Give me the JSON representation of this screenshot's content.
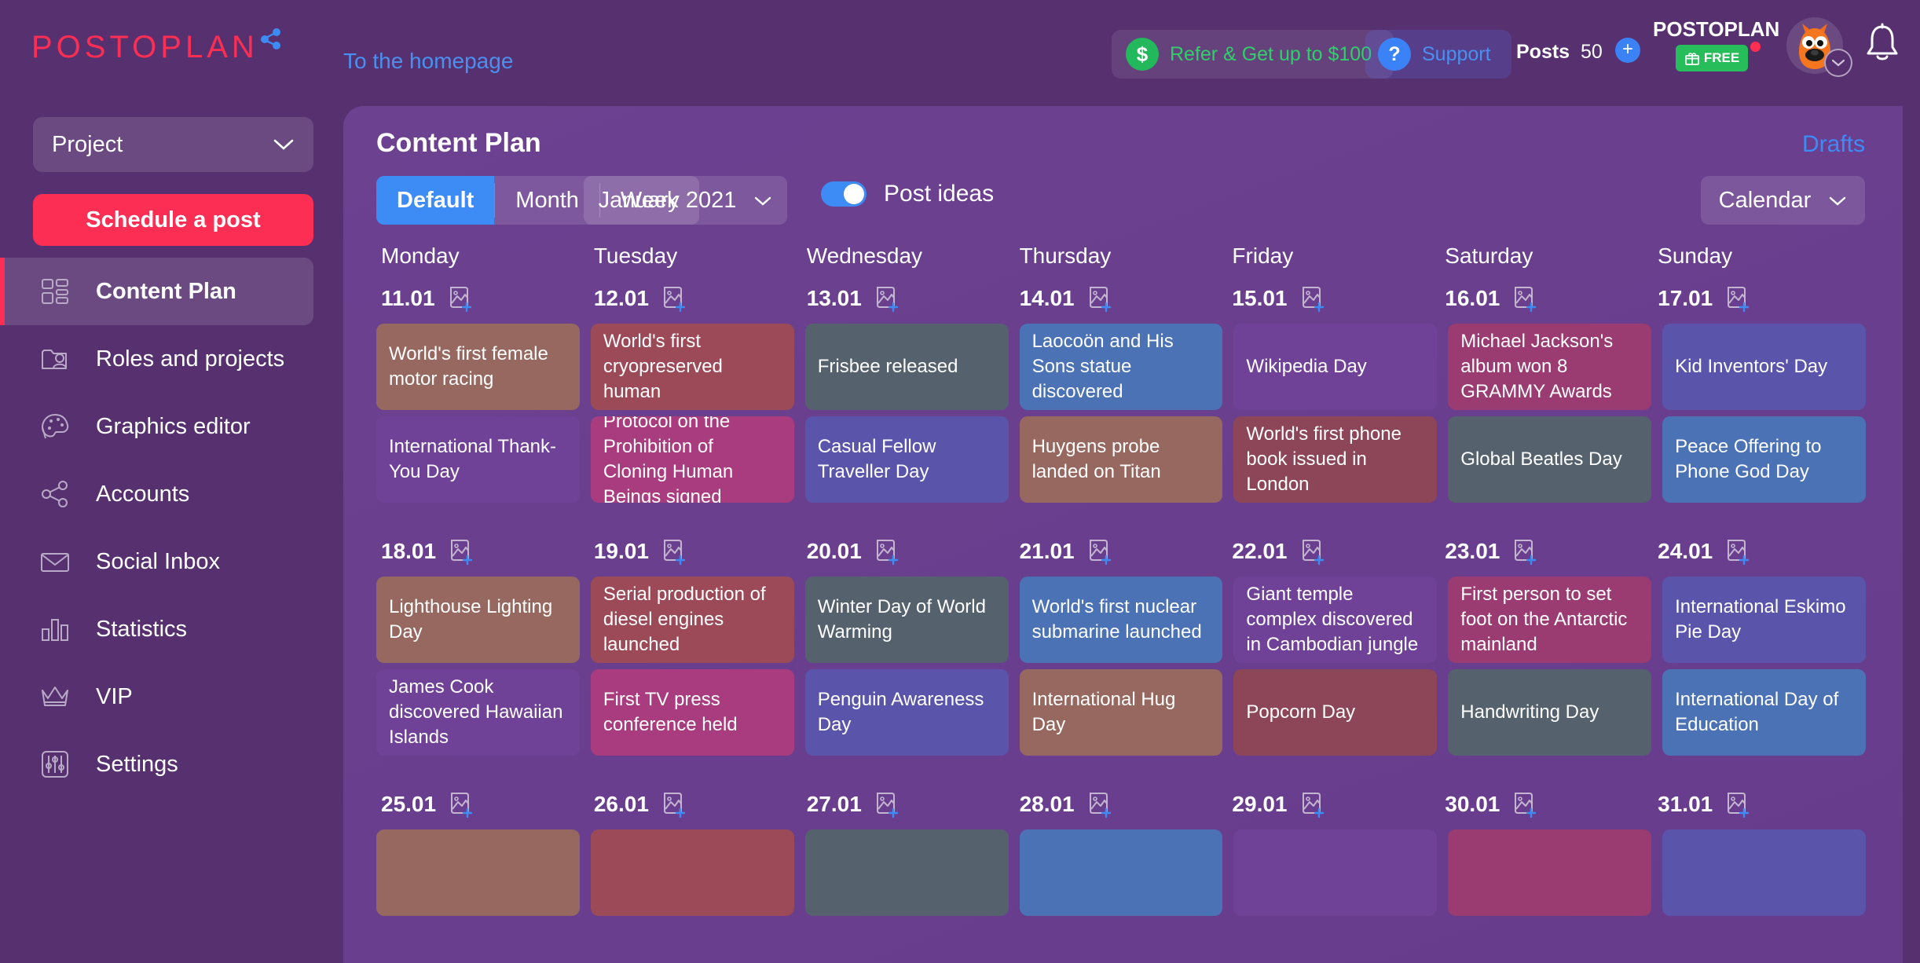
{
  "brand": {
    "logo_text": "POSTOPLAN",
    "logo_color": "#fd2e54",
    "share_icon": "share-icon"
  },
  "header": {
    "home_link": "To the homepage",
    "refer": {
      "label": "Refer & Get up to $100",
      "icon": "dollar-icon",
      "color": "#2fd06a"
    },
    "support": {
      "label": "Support",
      "icon": "question-icon",
      "color": "#4a90ef"
    },
    "posts": {
      "label": "Posts",
      "count": "50",
      "add_icon": "plus-icon"
    },
    "plan": {
      "name": "POSTOPLAN",
      "badge": "FREE",
      "badge_icon": "gift-icon",
      "badge_color": "#27bd5a"
    },
    "avatar": {
      "name": "avatar",
      "chevron": "chevron-down-icon"
    },
    "bell": "bell-icon"
  },
  "sidebar": {
    "project_select": {
      "label": "Project",
      "chevron": "chevron-down-icon"
    },
    "schedule_button": "Schedule a post",
    "items": [
      {
        "label": "Content Plan",
        "icon": "grid-icon",
        "active": true
      },
      {
        "label": "Roles and projects",
        "icon": "folder-user-icon",
        "active": false
      },
      {
        "label": "Graphics editor",
        "icon": "palette-icon",
        "active": false
      },
      {
        "label": "Accounts",
        "icon": "share-nodes-icon",
        "active": false
      },
      {
        "label": "Social Inbox",
        "icon": "envelope-icon",
        "active": false
      },
      {
        "label": "Statistics",
        "icon": "bar-chart-icon",
        "active": false
      },
      {
        "label": "VIP",
        "icon": "crown-icon",
        "active": false
      },
      {
        "label": "Settings",
        "icon": "sliders-icon",
        "active": false
      }
    ],
    "accent_color": "#fd2e54"
  },
  "main": {
    "title": "Content Plan",
    "drafts_link": "Drafts",
    "view_tabs": [
      {
        "label": "Default",
        "active": true
      },
      {
        "label": "Month",
        "active": false
      },
      {
        "label": "Week",
        "active": false
      }
    ],
    "month_select": {
      "value": "January 2021",
      "chevron": "chevron-down-icon"
    },
    "post_ideas": {
      "label": "Post ideas",
      "enabled": true,
      "color": "#3d8bf5"
    },
    "calendar_select": {
      "value": "Calendar",
      "chevron": "chevron-down-icon"
    },
    "weekdays": [
      "Monday",
      "Tuesday",
      "Wednesday",
      "Thursday",
      "Friday",
      "Saturday",
      "Sunday"
    ],
    "add_image_icon": "image-add-icon",
    "weeks": [
      {
        "dates": [
          "11.01",
          "12.01",
          "13.01",
          "14.01",
          "15.01",
          "16.01",
          "17.01"
        ],
        "rows": [
          [
            {
              "text": "World's first female motor racing",
              "color": "#96685f"
            },
            {
              "text": "World's first cryopreserved human",
              "color": "#9c4a58"
            },
            {
              "text": "Frisbee released",
              "color": "#55626e"
            },
            {
              "text": "Laocoön and His Sons statue discovered",
              "color": "#4a72b5"
            },
            {
              "text": "Wikipedia Day",
              "color": "#6f4298"
            },
            {
              "text": "Michael Jackson's album won 8 GRAMMY Awards",
              "color": "#9a3b71"
            },
            {
              "text": "Kid Inventors' Day",
              "color": "#5a55ab"
            }
          ],
          [
            {
              "text": "International Thank-You Day",
              "color": "#6f4298"
            },
            {
              "text": "Protocol on the Prohibition of Cloning Human Beings signed",
              "color": "#a93c7e"
            },
            {
              "text": "Casual Fellow Traveller Day",
              "color": "#5a55ab"
            },
            {
              "text": "Huygens probe landed on Titan",
              "color": "#96685f"
            },
            {
              "text": "World's first phone book issued in London",
              "color": "#8d4658"
            },
            {
              "text": "Global Beatles Day",
              "color": "#55626e"
            },
            {
              "text": "Peace Offering to Phone God Day",
              "color": "#4a72b5"
            }
          ]
        ]
      },
      {
        "dates": [
          "18.01",
          "19.01",
          "20.01",
          "21.01",
          "22.01",
          "23.01",
          "24.01"
        ],
        "rows": [
          [
            {
              "text": "Lighthouse Lighting Day",
              "color": "#96685f"
            },
            {
              "text": "Serial production of diesel engines launched",
              "color": "#9c4a58"
            },
            {
              "text": "Winter Day of World Warming",
              "color": "#55626e"
            },
            {
              "text": "World's first nuclear submarine launched",
              "color": "#4a72b5"
            },
            {
              "text": "Giant temple complex discovered in Cambodian jungle",
              "color": "#6f4298"
            },
            {
              "text": "First person to set foot on the Antarctic mainland",
              "color": "#9a3b71"
            },
            {
              "text": "International Eskimo Pie Day",
              "color": "#5a55ab"
            }
          ],
          [
            {
              "text": "James Cook discovered Hawaiian Islands",
              "color": "#6f4298"
            },
            {
              "text": "First TV press conference held",
              "color": "#a93c7e"
            },
            {
              "text": "Penguin Awareness Day",
              "color": "#5a55ab"
            },
            {
              "text": "International Hug Day",
              "color": "#96685f"
            },
            {
              "text": "Popcorn Day",
              "color": "#8d4658"
            },
            {
              "text": "Handwriting Day",
              "color": "#55626e"
            },
            {
              "text": "International Day of Education",
              "color": "#4a72b5"
            }
          ]
        ]
      },
      {
        "dates": [
          "25.01",
          "26.01",
          "27.01",
          "28.01",
          "29.01",
          "30.01",
          "31.01"
        ],
        "rows": [
          [
            {
              "text": "",
              "color": "#96685f"
            },
            {
              "text": "",
              "color": "#9c4a58"
            },
            {
              "text": "",
              "color": "#55626e"
            },
            {
              "text": "",
              "color": "#4a72b5"
            },
            {
              "text": "",
              "color": "#6f4298"
            },
            {
              "text": "",
              "color": "#9a3b71"
            },
            {
              "text": "",
              "color": "#5a55ab"
            }
          ]
        ]
      }
    ]
  }
}
